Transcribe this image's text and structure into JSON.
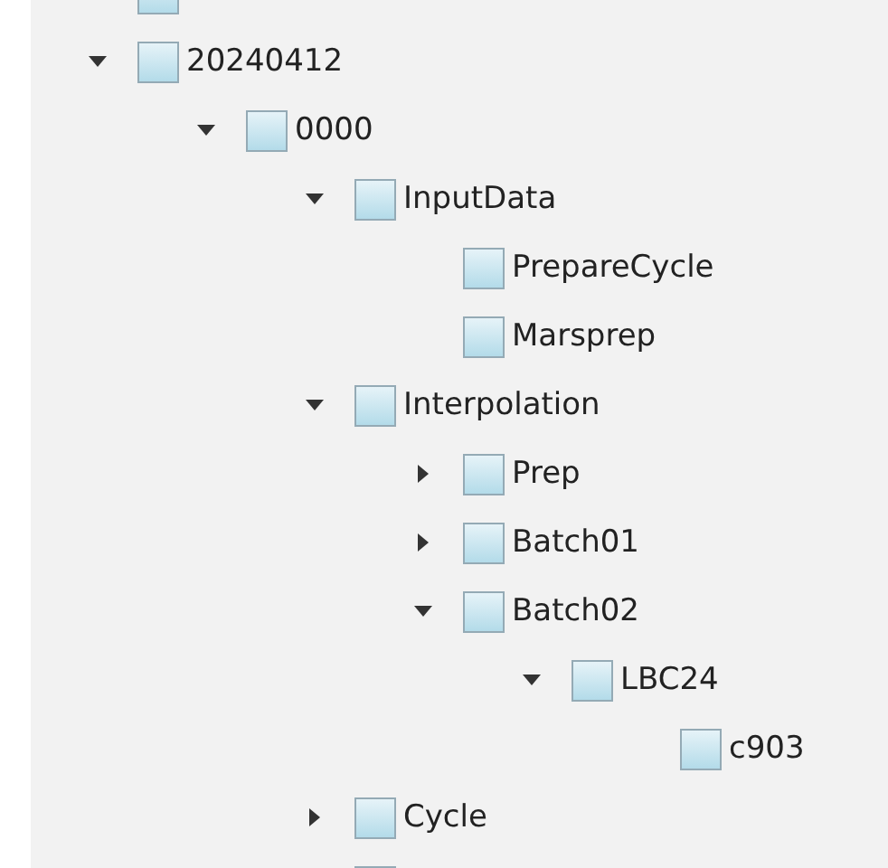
{
  "tree": [
    {
      "kind": "cut"
    },
    {
      "kind": "node",
      "label": "20240412",
      "expanded": true,
      "children": [
        {
          "kind": "node",
          "label": "0000",
          "expanded": true,
          "children": [
            {
              "kind": "node",
              "label": "InputData",
              "expanded": true,
              "children": [
                {
                  "kind": "node",
                  "label": "PrepareCycle"
                },
                {
                  "kind": "node",
                  "label": "Marsprep"
                }
              ]
            },
            {
              "kind": "node",
              "label": "Interpolation",
              "expanded": true,
              "children": [
                {
                  "kind": "node",
                  "label": "Prep",
                  "expanded": false
                },
                {
                  "kind": "node",
                  "label": "Batch01",
                  "expanded": false
                },
                {
                  "kind": "node",
                  "label": "Batch02",
                  "expanded": true,
                  "children": [
                    {
                      "kind": "node",
                      "label": "LBC24",
                      "expanded": true,
                      "children": [
                        {
                          "kind": "node",
                          "label": "c903"
                        }
                      ]
                    }
                  ]
                }
              ]
            },
            {
              "kind": "node",
              "label": "Cycle",
              "expanded": false
            },
            {
              "kind": "cut"
            }
          ]
        }
      ]
    }
  ]
}
